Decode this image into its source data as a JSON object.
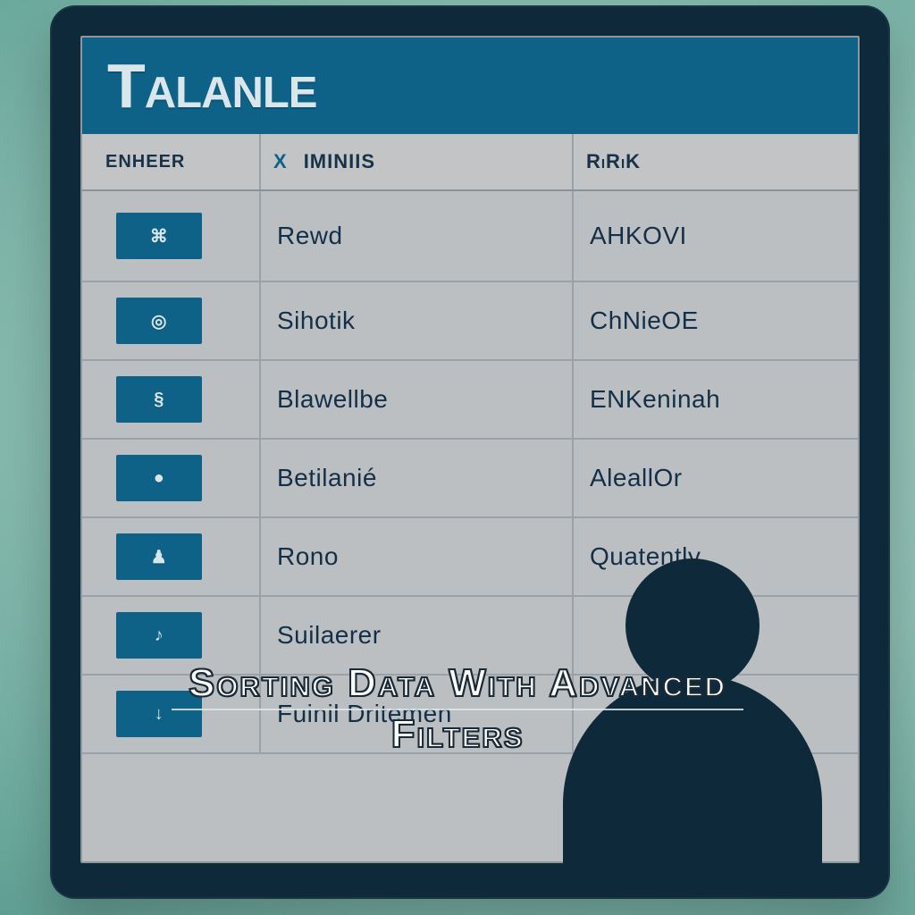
{
  "colors": {
    "accent": "#0e6187",
    "device": "#0e2a3a",
    "panel_bg": "#bcbfc2",
    "text": "#142f48"
  },
  "app": {
    "title": "Talanle"
  },
  "table": {
    "headers": {
      "col1": "ENHEER",
      "col2_marker": "X",
      "col2": "IMINIIS",
      "col3": "RiRiK"
    },
    "rows": [
      {
        "icon_glyph": "⌘",
        "icon_name": "generic-icon",
        "name": "Rewd",
        "value": "AHKOVI"
      },
      {
        "icon_glyph": "◎",
        "icon_name": "ring-icon",
        "name": "Sihotik",
        "value": "ChNieOE"
      },
      {
        "icon_glyph": "§",
        "icon_name": "section-icon",
        "name": "Blawellbe",
        "value": "ENKeninah"
      },
      {
        "icon_glyph": "●",
        "icon_name": "dot-icon",
        "name": "Betilanié",
        "value": "AleallOr"
      },
      {
        "icon_glyph": "♟",
        "icon_name": "pawn-icon",
        "name": "Rono",
        "value": "Quatently"
      },
      {
        "icon_glyph": "♪",
        "icon_name": "note-icon",
        "name": "Suilaerer",
        "value": ""
      },
      {
        "icon_glyph": "↓",
        "icon_name": "arrow-down-icon",
        "name": "Fuinil Dritemen",
        "value": ""
      }
    ]
  },
  "overlay": {
    "line1": "Sorting Data With Advanced",
    "line2": "Filters"
  }
}
